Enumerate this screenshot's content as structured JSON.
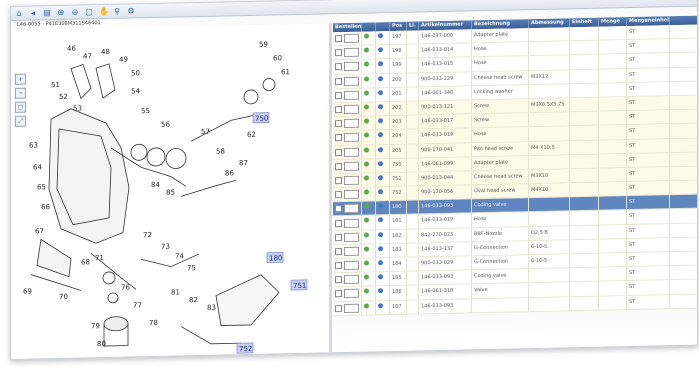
{
  "toolbar": {
    "icons": [
      "home-icon",
      "back-icon",
      "print-icon",
      "zoom-in-icon",
      "zoom-out-icon",
      "fit-icon",
      "pan-icon",
      "search-icon",
      "settings-icon"
    ],
    "glyphs": [
      "⌂",
      "◂",
      "▤",
      "⊕",
      "⊖",
      "▢",
      "✋",
      "⚲",
      "⚙"
    ]
  },
  "path_text": "L46-0055 - P41E308M311S46401",
  "side_glyphs": [
    "+",
    "−",
    "▢",
    "⤢"
  ],
  "callouts": [
    "46",
    "47",
    "48",
    "49",
    "50",
    "51",
    "52",
    "53",
    "54",
    "55",
    "56",
    "57",
    "58",
    "59",
    "60",
    "61",
    "62",
    "63",
    "64",
    "65",
    "66",
    "67",
    "68",
    "69",
    "70",
    "71",
    "72",
    "73",
    "74",
    "75",
    "76",
    "77",
    "78",
    "79",
    "80",
    "81",
    "82",
    "83",
    "84",
    "85",
    "86",
    "87"
  ],
  "highlights": [
    "750",
    "180",
    "751",
    "752"
  ],
  "grid": {
    "headers": [
      "Bestellen",
      "",
      "",
      "Pos",
      "Li.",
      "Artikelnummer",
      "Bezeichnung",
      "Abmessung",
      "Einheit",
      "Menge",
      "Mengeneinheit"
    ],
    "rows": [
      {
        "pos": "197",
        "art": "146-037-000",
        "desc": "Adapter plate",
        "dim": "",
        "unit": "ST"
      },
      {
        "pos": "198",
        "art": "146-033-014",
        "desc": "Hose",
        "dim": "",
        "unit": "ST"
      },
      {
        "pos": "199",
        "art": "146-033-015",
        "desc": "Hose",
        "dim": "",
        "unit": "ST"
      },
      {
        "pos": "200",
        "art": "900-033-229",
        "desc": "Cheese head screw",
        "dim": "M3X12",
        "unit": "ST"
      },
      {
        "pos": "201",
        "art": "146-001-340",
        "desc": "Locking washer",
        "dim": "",
        "unit": "ST"
      },
      {
        "pos": "202",
        "art": "900-013-121",
        "desc": "Screw",
        "dim": "M3X8.5X5.75",
        "unit": "ST"
      },
      {
        "pos": "203",
        "art": "146-033-017",
        "desc": "Screw",
        "dim": "",
        "unit": "ST"
      },
      {
        "pos": "204",
        "art": "146-033-019",
        "desc": "Hose",
        "dim": "",
        "unit": "ST"
      },
      {
        "pos": "205",
        "art": "900-170-041",
        "desc": "Pan head screw",
        "dim": "M4 X10.5",
        "unit": "ST"
      },
      {
        "pos": "750",
        "art": "146-061-099",
        "desc": "Adapter plate",
        "dim": "",
        "unit": "ST"
      },
      {
        "pos": "751",
        "art": "900-013-044",
        "desc": "Cheese head screw",
        "dim": "M3X10",
        "unit": "ST"
      },
      {
        "pos": "752",
        "art": "900-170-056",
        "desc": "Oval head screw",
        "dim": "M4X10",
        "unit": "ST"
      },
      {
        "pos": "180",
        "art": "146-033-093",
        "desc": "Coding valve",
        "dim": "",
        "unit": "ST"
      },
      {
        "pos": "181",
        "art": "146-033-019",
        "desc": "Hose",
        "dim": "",
        "unit": "ST"
      },
      {
        "pos": "182",
        "art": "842-270-023",
        "desc": "BBF-Nozzle",
        "dim": "D2,5 B",
        "unit": "ST"
      },
      {
        "pos": "183",
        "art": "146-013-137",
        "desc": "G-Connection",
        "dim": "6-10-5",
        "unit": "ST"
      },
      {
        "pos": "184",
        "art": "900-033-029",
        "desc": "G-Connection",
        "dim": "6-10-5",
        "unit": "ST"
      },
      {
        "pos": "185",
        "art": "146-033-093",
        "desc": "Coding valve",
        "dim": "",
        "unit": "ST"
      },
      {
        "pos": "186",
        "art": "146-061-318",
        "desc": "Valve",
        "dim": "",
        "unit": "ST"
      },
      {
        "pos": "187",
        "art": "146-033-093",
        "desc": "",
        "dim": "",
        "unit": "ST"
      }
    ],
    "row_styles": [
      "w",
      "w",
      "w",
      "w",
      "w",
      "y",
      "y",
      "y",
      "y",
      "y",
      "y",
      "y",
      "sel",
      "w",
      "w",
      "w",
      "w",
      "w",
      "w",
      "w"
    ]
  },
  "colors": {
    "header": "#4a6fa8",
    "selected": "#5f86bf",
    "highlight_row": "#fdfbe8",
    "dot_green": "#5aa84a",
    "dot_blue": "#3f78c8"
  }
}
